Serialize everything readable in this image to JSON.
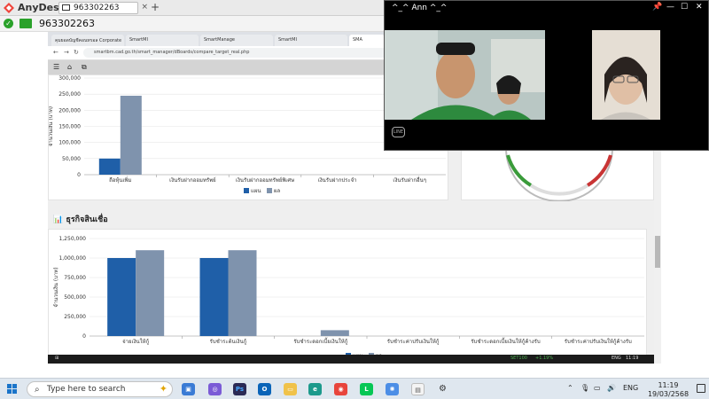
{
  "anydesk": {
    "brand": "AnyDesk",
    "tab_id": "963302263",
    "session_id": "963302263"
  },
  "browser": {
    "tabs": [
      "คุมยอดบัญชีคอนทรอล Corporate",
      "SmartMI",
      "SmartManage",
      "SmartMI",
      "SMA"
    ],
    "url": "smartbm.cad.go.th/smart_manager/dBoards/compare_target_real.php"
  },
  "chart1": {
    "ylabel": "จำนวนเงิน (บาท)",
    "legend_plan": "แผน",
    "legend_actual": "ผล"
  },
  "chart2": {
    "section_title": "ธุรกิจสินเชื่อ",
    "ylabel": "จำนวนเงิน (บาท)",
    "legend_plan": "แผน",
    "legend_actual": "ผล"
  },
  "chart_data": [
    {
      "type": "bar",
      "categories": [
        "ถือหุ้นเพิ่ม",
        "เงินรับฝากออมทรัพย์",
        "เงินรับฝากออมทรัพย์พิเศษ",
        "เงินรับฝากประจำ",
        "เงินรับฝากอื่นๆ"
      ],
      "series": [
        {
          "name": "แผน",
          "values": [
            50000,
            0,
            0,
            0,
            0
          ]
        },
        {
          "name": "ผล",
          "values": [
            245000,
            0,
            0,
            0,
            0
          ]
        }
      ],
      "ylabel": "จำนวนเงิน (บาท)",
      "ylim": [
        0,
        300000
      ],
      "yticks": [
        "0",
        "50,000",
        "100,000",
        "150,000",
        "200,000",
        "250,000",
        "300,000"
      ],
      "colors": [
        "#1f5fa8",
        "#7f93ad"
      ]
    },
    {
      "type": "bar",
      "categories": [
        "จ่ายเงินให้กู้",
        "รับชำระต้นเงินกู้",
        "รับชำระดอกเบี้ยเงินให้กู้",
        "รับชำระค่าปรับเงินให้กู้",
        "รับชำระดอกเบี้ยเงินให้กู้ค้างรับ",
        "รับชำระค่าปรับเงินให้กู้ค้างรับ"
      ],
      "series": [
        {
          "name": "แผน",
          "values": [
            1000000,
            1000000,
            0,
            0,
            0,
            0
          ]
        },
        {
          "name": "ผล",
          "values": [
            1100000,
            1100000,
            75000,
            0,
            0,
            0
          ]
        }
      ],
      "ylabel": "จำนวนเงิน (บาท)",
      "ylim": [
        0,
        1250000
      ],
      "yticks": [
        "0",
        "250,000",
        "500,000",
        "750,000",
        "1,000,000",
        "1,250,000"
      ],
      "colors": [
        "#1f5fa8",
        "#7f93ad"
      ]
    }
  ],
  "video_call": {
    "title": "^_^ Ann ^_^",
    "logo": "LINE"
  },
  "taskbar": {
    "search_placeholder": "Type here to search",
    "lang": "ENG",
    "time": "11:19",
    "date": "19/03/2568"
  },
  "remote_taskbar": {
    "set_label": "SET100",
    "set_change": "+1.19%",
    "time": "11:19",
    "date": "19-มี.ค.-2568",
    "lang": "ENG"
  }
}
